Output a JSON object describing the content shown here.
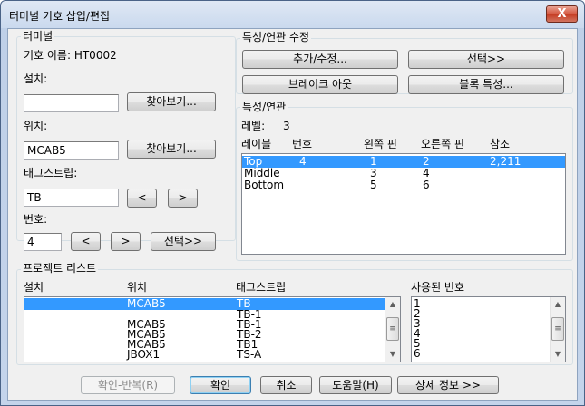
{
  "window": {
    "title": "터미널 기호 삽입/편집",
    "close_glyph": "X"
  },
  "terminal": {
    "group_label": "터미널",
    "symbol_name": "기호 이름: HT0002",
    "install_label": "설치:",
    "install_value": "",
    "browse1": "찾아보기...",
    "location_label": "위치:",
    "location_value": "MCAB5",
    "browse2": "찾아보기...",
    "tagstrip_label": "태그스트립:",
    "tagstrip_value": "TB",
    "prev": "<",
    "next": ">",
    "number_label": "번호:",
    "number_value": "4",
    "select": "선택>>"
  },
  "props": {
    "group_label": "특성/연관 수정",
    "add_edit": "추가/수정...",
    "select": "선택>>",
    "break_out": "브레이크 아웃",
    "block_props": "블록 특성..."
  },
  "assoc": {
    "group_label": "특성/연관",
    "level_label": "레벨:",
    "level_value": "3",
    "columns": [
      "레이블",
      "번호",
      "왼쪽 핀",
      "오른쪽 핀",
      "참조"
    ],
    "rows": [
      [
        "Top",
        "4",
        "1",
        "2",
        "2,211"
      ],
      [
        "Middle",
        "",
        "3",
        "4",
        ""
      ],
      [
        "Bottom",
        "",
        "5",
        "6",
        ""
      ]
    ]
  },
  "project": {
    "group_label": "프로젝트 리스트",
    "columns": [
      "설치",
      "위치",
      "태그스트립"
    ],
    "used_label": "사용된 번호",
    "rows": [
      [
        "",
        "MCAB5",
        "TB"
      ],
      [
        "",
        "",
        "TB-1"
      ],
      [
        "",
        "MCAB5",
        "TB-1"
      ],
      [
        "",
        "MCAB5",
        "TB-2"
      ],
      [
        "",
        "MCAB5",
        "TB1"
      ],
      [
        "",
        "JBOX1",
        "TS-A"
      ]
    ],
    "used_numbers": [
      "1",
      "2",
      "3",
      "4",
      "5",
      "6"
    ]
  },
  "footer": {
    "ok_repeat": "확인-반복(R)",
    "ok": "확인",
    "cancel": "취소",
    "help": "도움말(H)",
    "details": "상세 정보 >>"
  }
}
